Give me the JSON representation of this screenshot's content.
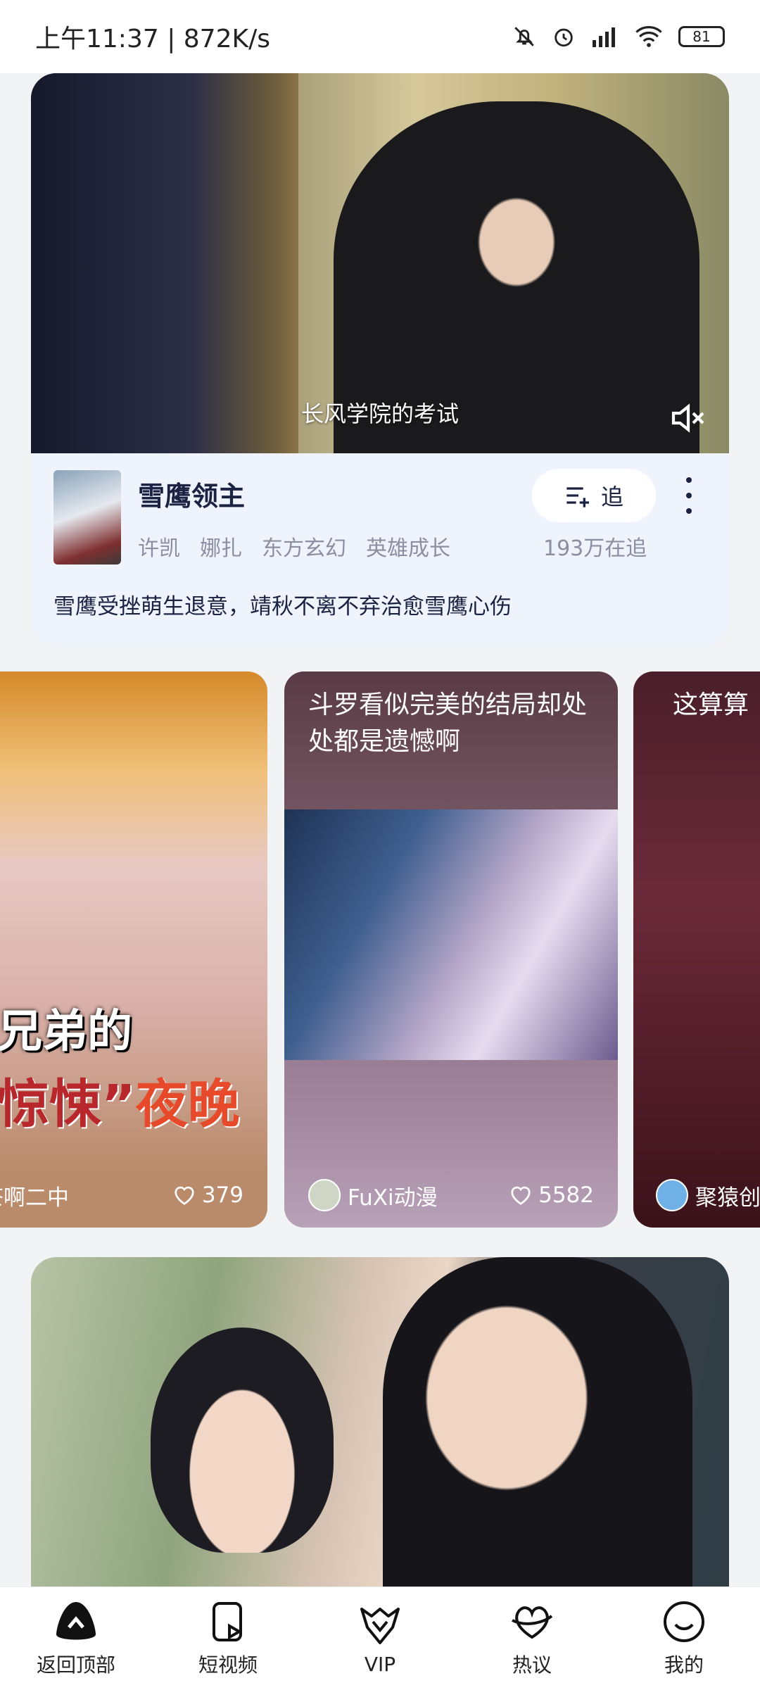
{
  "status_bar": {
    "time_speed": "上午11:37 | 872K/s",
    "battery": "81"
  },
  "hero": {
    "subtitle": "长风学院的考试",
    "title": "雪鹰领主",
    "tags": [
      "许凯",
      "娜扎",
      "东方玄幻",
      "英雄成长"
    ],
    "follow_label": "追",
    "follow_count": "193万在追",
    "description": "雪鹰受挫萌生退意，靖秋不离不弃治愈雪鹰心伤"
  },
  "shorts": [
    {
      "overlay_line1": "兄弟的",
      "overlay_line2a": "惊悚”",
      "overlay_line2b": "夜晚",
      "author": "茶啊二中",
      "likes": "379"
    },
    {
      "caption": "斗罗看似完美的结局却处处都是遗憾啊",
      "author": "FuXi动漫",
      "likes": "5582"
    },
    {
      "caption": "这算算",
      "author": "聚猿创"
    }
  ],
  "nav": {
    "items": [
      {
        "label": "返回顶部",
        "icon": "back-to-top-icon"
      },
      {
        "label": "短视频",
        "icon": "short-video-icon"
      },
      {
        "label": "VIP",
        "icon": "vip-crown-icon"
      },
      {
        "label": "热议",
        "icon": "hot-discussion-icon"
      },
      {
        "label": "我的",
        "icon": "profile-smile-icon"
      }
    ]
  }
}
